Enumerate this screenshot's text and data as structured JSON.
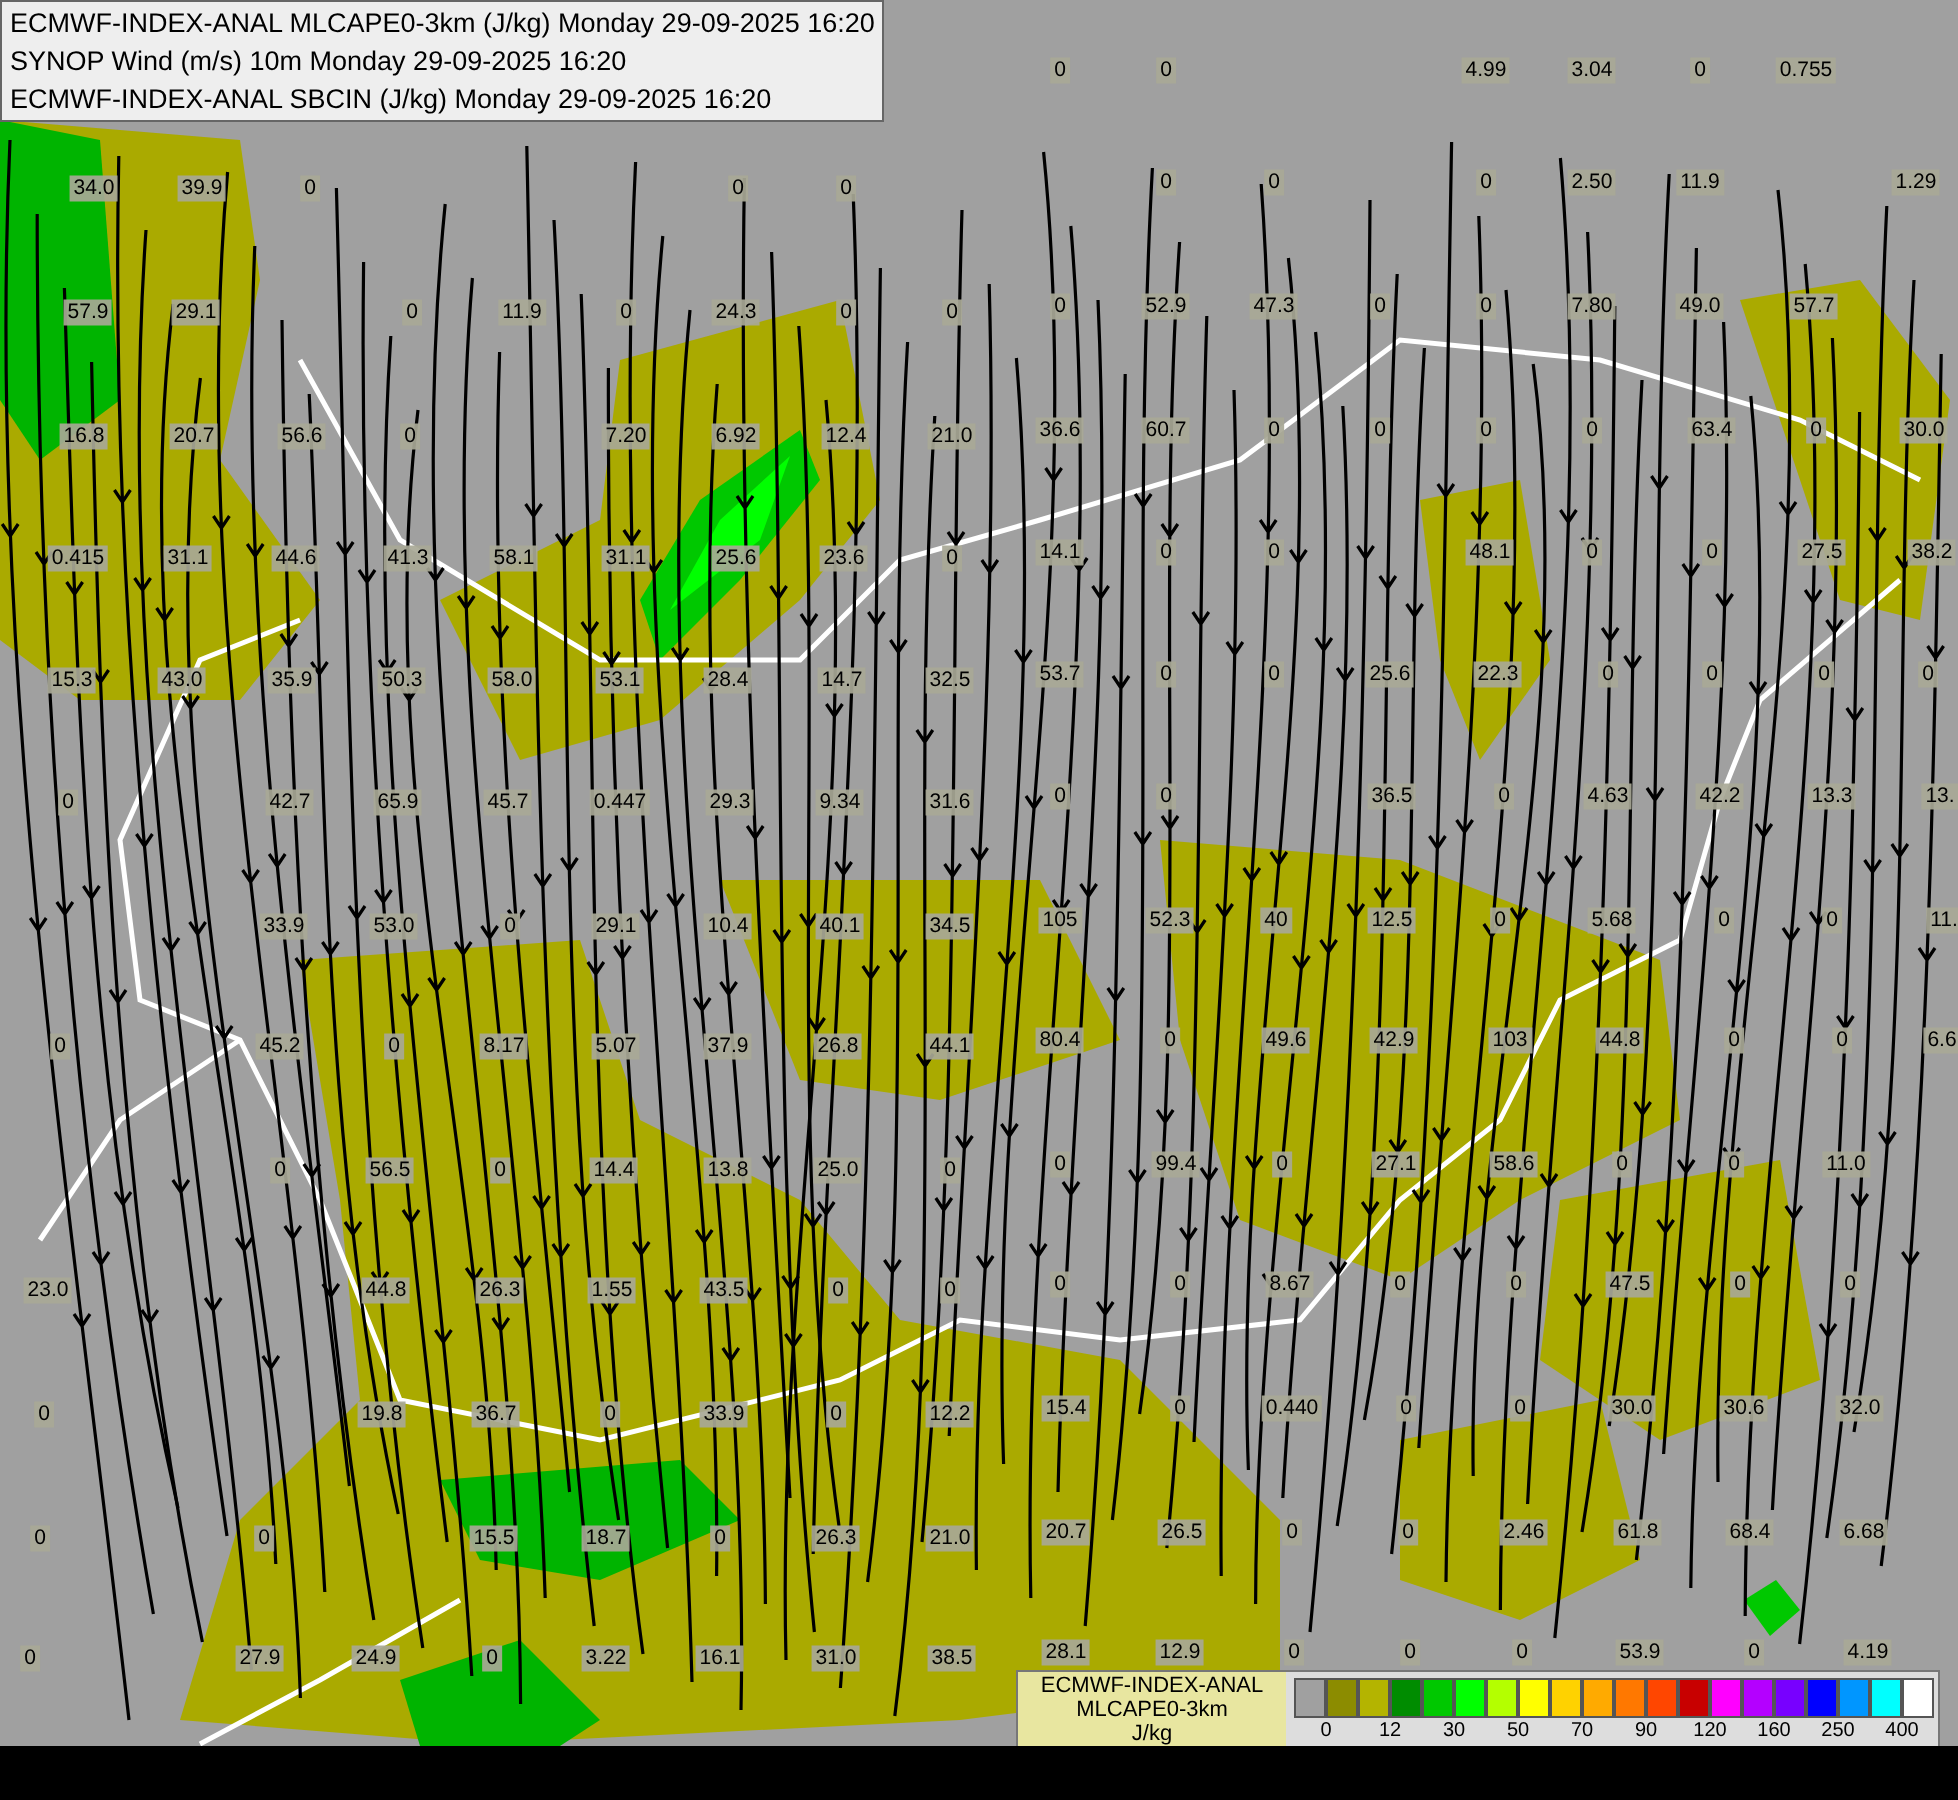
{
  "header": {
    "lines": [
      "ECMWF-INDEX-ANAL MLCAPE0-3km (J/kg) Monday 29-09-2025 16:20",
      "SYNOP Wind (m/s) 10m Monday 29-09-2025 16:20",
      "ECMWF-INDEX-ANAL SBCIN (J/kg) Monday 29-09-2025 16:20"
    ]
  },
  "map_values": [
    [
      "0",
      "0",
      "4.99",
      "3.04",
      "0",
      "0.755"
    ],
    [
      "34.0",
      "39.9",
      "0",
      "0",
      "0",
      "0",
      "0",
      "0",
      "2.50",
      "11.9",
      "1.29"
    ],
    [
      "57.9",
      "29.1",
      "0",
      "11.9",
      "0",
      "24.3",
      "0",
      "0",
      "0",
      "52.9",
      "47.3",
      "0",
      "0",
      "7.80",
      "49.0",
      "57.7"
    ],
    [
      "16.8",
      "20.7",
      "56.6",
      "0",
      "7.20",
      "6.92",
      "12.4",
      "21.0",
      "36.6",
      "60.7",
      "0",
      "0",
      "0",
      "0",
      "63.4",
      "0",
      "30.0"
    ],
    [
      "0.415",
      "31.1",
      "44.6",
      "41.3",
      "58.1",
      "31.1",
      "25.6",
      "23.6",
      "0",
      "14.1",
      "0",
      "0",
      "48.1",
      "0",
      "0",
      "27.5",
      "38.2"
    ],
    [
      "15.3",
      "43.0",
      "35.9",
      "50.3",
      "58.0",
      "53.1",
      "28.4",
      "14.7",
      "32.5",
      "53.7",
      "0",
      "0",
      "25.6",
      "22.3",
      "0",
      "0",
      "0",
      "0"
    ],
    [
      "0",
      "42.7",
      "65.9",
      "45.7",
      "0.447",
      "29.3",
      "9.34",
      "31.6",
      "0",
      "0",
      "36.5",
      "0",
      "4.63",
      "42.2",
      "13.3",
      "13."
    ],
    [
      "33.9",
      "53.0",
      "0",
      "29.1",
      "10.4",
      "40.1",
      "34.5",
      "105",
      "52.3",
      "40",
      "12.5",
      "0",
      "5.68",
      "0",
      "0",
      "11."
    ],
    [
      "0",
      "45.2",
      "0",
      "8.17",
      "5.07",
      "37.9",
      "26.8",
      "44.1",
      "80.4",
      "0",
      "49.6",
      "42.9",
      "103",
      "44.8",
      "0",
      "0",
      "6.6"
    ],
    [
      "0",
      "56.5",
      "0",
      "14.4",
      "13.8",
      "25.0",
      "0",
      "0",
      "99.4",
      "0",
      "27.1",
      "58.6",
      "0",
      "0",
      "11.0"
    ],
    [
      "23.0",
      "44.8",
      "26.3",
      "1.55",
      "43.5",
      "0",
      "0",
      "0",
      "0",
      "8.67",
      "0",
      "0",
      "47.5",
      "0",
      "0"
    ],
    [
      "0",
      "19.8",
      "36.7",
      "0",
      "33.9",
      "0",
      "12.2",
      "15.4",
      "0",
      "0.440",
      "0",
      "0",
      "30.0",
      "30.6",
      "32.0"
    ],
    [
      "0",
      "0",
      "15.5",
      "18.7",
      "0",
      "26.3",
      "21.0",
      "20.7",
      "26.5",
      "0",
      "0",
      "2.46",
      "61.8",
      "68.4",
      "6.68"
    ],
    [
      "0",
      "27.9",
      "24.9",
      "0",
      "3.22",
      "16.1",
      "31.0",
      "38.5",
      "28.1",
      "12.9",
      "0",
      "0",
      "0",
      "53.9",
      "0",
      "4.19"
    ]
  ],
  "legend": {
    "title_lines": [
      "ECMWF-INDEX-ANAL",
      "MLCAPE0-3km"
    ],
    "unit": "J/kg",
    "swatches": [
      {
        "color": "#a0a0a0"
      },
      {
        "color": "#8c8c00"
      },
      {
        "color": "#b4b400"
      },
      {
        "color": "#008c00"
      },
      {
        "color": "#00c800"
      },
      {
        "color": "#00ff00"
      },
      {
        "color": "#b4ff00"
      },
      {
        "color": "#ffff00"
      },
      {
        "color": "#ffd200"
      },
      {
        "color": "#ffaa00"
      },
      {
        "color": "#ff7800"
      },
      {
        "color": "#ff4600"
      },
      {
        "color": "#c80000"
      },
      {
        "color": "#ff00ff"
      },
      {
        "color": "#b400ff"
      },
      {
        "color": "#7800ff"
      },
      {
        "color": "#0000ff"
      },
      {
        "color": "#0096ff"
      },
      {
        "color": "#00ffff"
      },
      {
        "color": "#ffffff"
      }
    ],
    "ticks": [
      "0",
      "12",
      "30",
      "50",
      "70",
      "90",
      "120",
      "160",
      "250",
      "400"
    ]
  }
}
